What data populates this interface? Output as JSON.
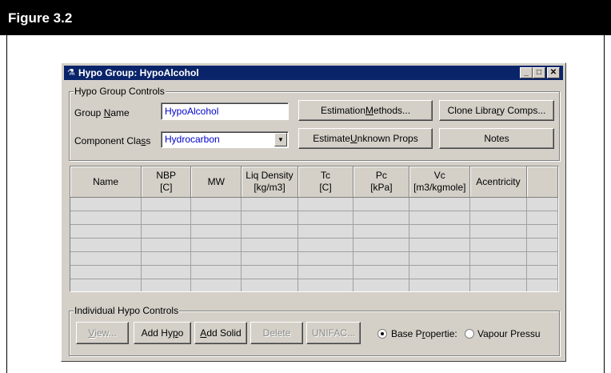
{
  "figure": {
    "title": "Figure 3.2"
  },
  "window": {
    "title": "Hypo Group: HypoAlcohol",
    "controls": {
      "minimize": "_",
      "maximize": "□",
      "close": "✕"
    }
  },
  "group_controls": {
    "legend": "Hypo Group Controls",
    "group_name_label_pre": "Group ",
    "group_name_label_u": "N",
    "group_name_label_post": "ame",
    "group_name_value": "HypoAlcohol",
    "component_class_label_pre": "Component Cla",
    "component_class_label_u": "s",
    "component_class_label_post": "s",
    "component_class_value": "Hydrocarbon",
    "estimation_methods": {
      "pre": "Estimation ",
      "u": "M",
      "post": "ethods..."
    },
    "clone_library": {
      "pre": "Clone Libra",
      "u": "r",
      "post": "y Comps..."
    },
    "estimate_unknown": {
      "pre": "Estimate ",
      "u": "U",
      "post": "nknown Props"
    },
    "notes": "Notes"
  },
  "grid": {
    "columns": [
      {
        "line1": "Name",
        "line2": ""
      },
      {
        "line1": "NBP",
        "line2": "[C]"
      },
      {
        "line1": "MW",
        "line2": ""
      },
      {
        "line1": "Liq Density",
        "line2": "[kg/m3]"
      },
      {
        "line1": "Tc",
        "line2": "[C]"
      },
      {
        "line1": "Pc",
        "line2": "[kPa]"
      },
      {
        "line1": "Vc",
        "line2": "[m3/kgmole]"
      },
      {
        "line1": "Acentricity",
        "line2": ""
      },
      {
        "line1": "",
        "line2": ""
      }
    ]
  },
  "individual_controls": {
    "legend": "Individual Hypo Controls",
    "view": {
      "pre": "",
      "u": "V",
      "post": "iew..."
    },
    "add_hypo": {
      "pre": "Add Hy",
      "u": "p",
      "post": "o"
    },
    "add_solid": {
      "pre": "",
      "u": "A",
      "post": "dd Solid"
    },
    "delete": "Delete",
    "unifac": "UNIFAC...",
    "base_properties": {
      "pre": "Base P",
      "u": "r",
      "post": "opertie:"
    },
    "vapour_pressure": "Vapour Pressu"
  }
}
